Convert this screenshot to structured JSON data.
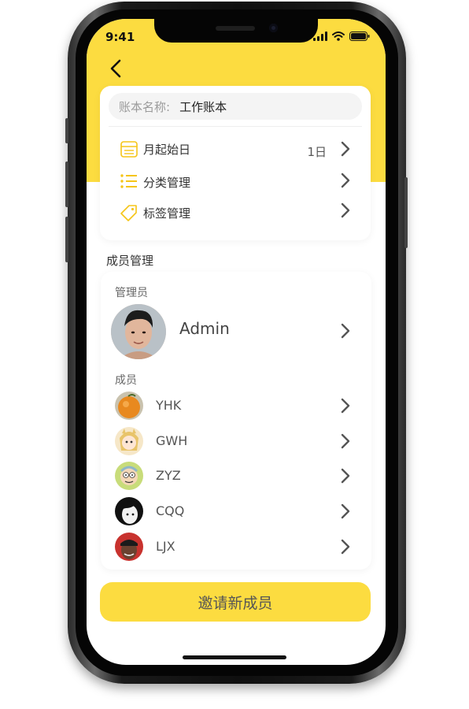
{
  "status_bar": {
    "time": "9:41"
  },
  "account": {
    "name_label": "账本名称:",
    "name_value": "工作账本",
    "rows": [
      {
        "label": "月起始日",
        "value": "1日",
        "icon": "calendar-icon"
      },
      {
        "label": "分类管理",
        "value": "",
        "icon": "list-icon"
      },
      {
        "label": "标签管理",
        "value": "",
        "icon": "tag-icon"
      }
    ]
  },
  "members": {
    "section_title": "成员管理",
    "admin_label": "管理员",
    "admin_name": "Admin",
    "members_label": "成员",
    "list": [
      {
        "name": "YHK"
      },
      {
        "name": "GWH"
      },
      {
        "name": "ZYZ"
      },
      {
        "name": "CQQ"
      },
      {
        "name": "LJX"
      }
    ]
  },
  "invite_button": "邀请新成员",
  "colors": {
    "accent": "#fcdc40",
    "text": "#333333",
    "muted": "#9b9b9b"
  }
}
